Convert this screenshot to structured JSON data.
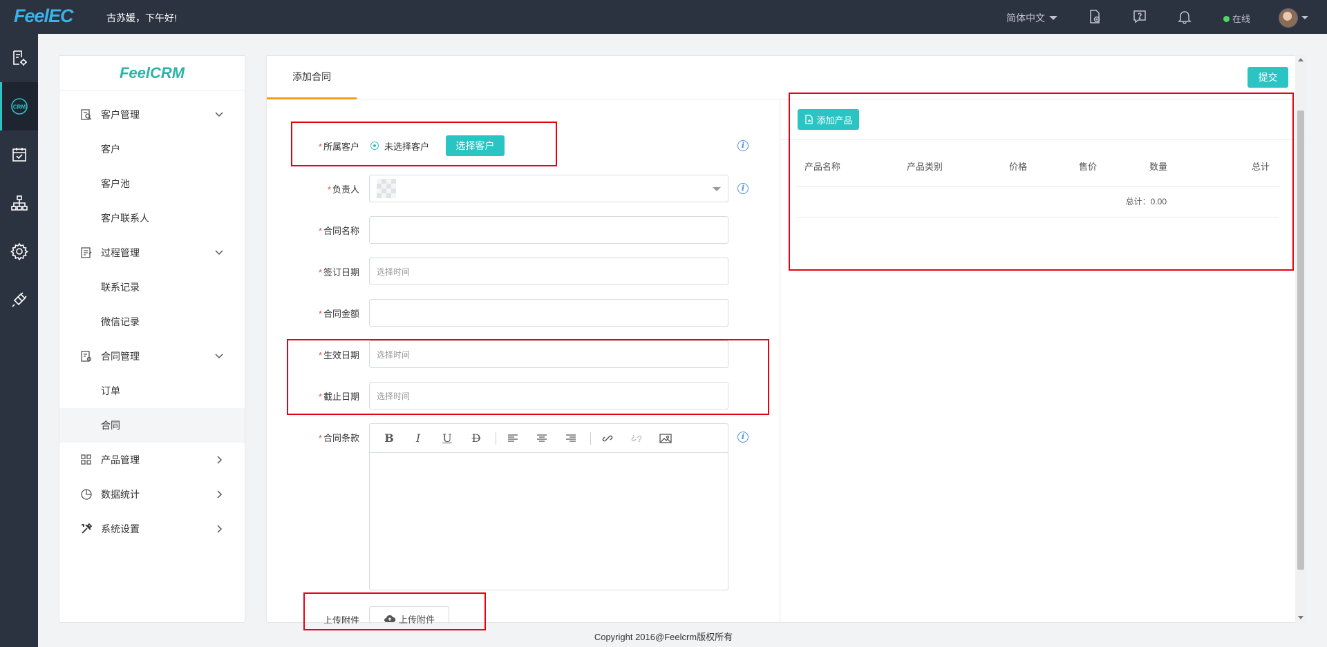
{
  "app": {
    "logo": "FeelEC",
    "greeting": "古苏媛，下午好!",
    "language": "简体中文",
    "status": "在线"
  },
  "rail": {
    "icons": [
      "report-gear-icon",
      "crm-icon",
      "calendar-check-icon",
      "org-chart-icon",
      "settings-icon",
      "plug-icon"
    ]
  },
  "sidebar": {
    "brand": "FeelCRM",
    "groups": [
      {
        "label": "客户管理",
        "icon": "customer-icon",
        "expanded": true,
        "items": [
          "客户",
          "客户池",
          "客户联系人"
        ]
      },
      {
        "label": "过程管理",
        "icon": "process-icon",
        "expanded": true,
        "items": [
          "联系记录",
          "微信记录"
        ]
      },
      {
        "label": "合同管理",
        "icon": "contract-icon",
        "expanded": true,
        "items": [
          "订单",
          "合同"
        ]
      },
      {
        "label": "产品管理",
        "icon": "product-icon",
        "expanded": false,
        "items": []
      },
      {
        "label": "数据统计",
        "icon": "pie-chart-icon",
        "expanded": false,
        "items": []
      },
      {
        "label": "系统设置",
        "icon": "tools-icon",
        "expanded": false,
        "items": []
      }
    ],
    "active_item": "合同"
  },
  "main": {
    "tab": "添加合同",
    "submit_label": "提交"
  },
  "form": {
    "customer": {
      "label": "所属客户",
      "radio_label": "未选择客户",
      "button": "选择客户"
    },
    "owner": {
      "label": "负责人"
    },
    "contract_name": {
      "label": "合同名称",
      "value": ""
    },
    "sign_date": {
      "label": "签订日期",
      "placeholder": "选择时间"
    },
    "amount": {
      "label": "合同金额",
      "value": ""
    },
    "start_date": {
      "label": "生效日期",
      "placeholder": "选择时间"
    },
    "end_date": {
      "label": "截止日期",
      "placeholder": "选择时间"
    },
    "terms": {
      "label": "合同条款"
    },
    "attachment": {
      "label": "上传附件",
      "button": "上传附件"
    }
  },
  "products": {
    "add_button": "添加产品",
    "columns": [
      "产品名称",
      "产品类别",
      "价格",
      "售价",
      "数量",
      "总计"
    ],
    "total": "总计：0.00"
  },
  "footer": "Copyright 2016@Feelcrm版权所有",
  "colors": {
    "accent": "#2bc4c4",
    "topbar": "#2b3240",
    "required": "#e94b3c",
    "highlight": "#e60012"
  }
}
